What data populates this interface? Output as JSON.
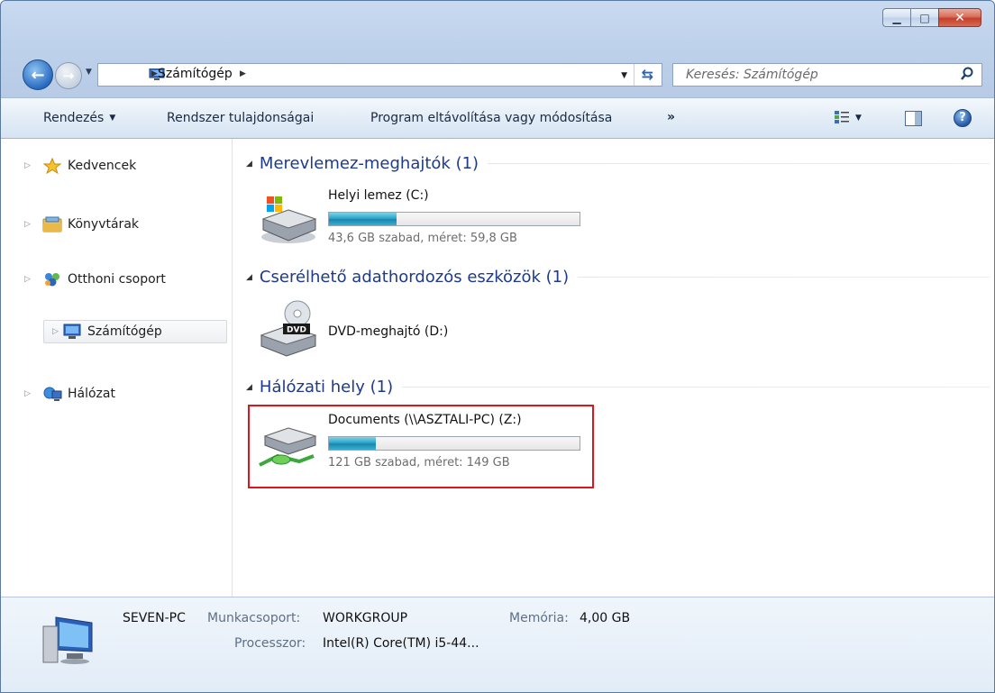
{
  "address": {
    "crumbs": [
      "Számítógép"
    ]
  },
  "search": {
    "placeholder": "Keresés: Számítógép"
  },
  "toolbar": {
    "organize": "Rendezés",
    "system_properties": "Rendszer tulajdonságai",
    "uninstall": "Program eltávolítása vagy módosítása",
    "more": "»"
  },
  "nav_pane": {
    "items": [
      {
        "label": "Kedvencek",
        "icon": "star-icon"
      },
      {
        "label": "Könyvtárak",
        "icon": "libraries-icon"
      },
      {
        "label": "Otthoni csoport",
        "icon": "homegroup-icon"
      },
      {
        "label": "Számítógép",
        "icon": "computer-icon",
        "selected": true
      },
      {
        "label": "Hálózat",
        "icon": "network-icon"
      }
    ]
  },
  "groups": [
    {
      "title": "Merevlemez-meghajtók (1)",
      "drives": [
        {
          "name": "Helyi lemez (C:)",
          "size_text": "43,6 GB szabad, méret: 59,8 GB",
          "used_fraction": 0.271,
          "icon": "hard-drive-icon"
        }
      ]
    },
    {
      "title": "Cserélhető adathordozós eszközök (1)",
      "drives": [
        {
          "name": "DVD-meghajtó (D:)",
          "icon": "dvd-drive-icon",
          "icon_label": "DVD"
        }
      ]
    },
    {
      "title": "Hálózati hely (1)",
      "drives": [
        {
          "name": "Documents (\\\\ASZTALI-PC) (Z:)",
          "size_text": "121 GB szabad, méret: 149 GB",
          "used_fraction": 0.188,
          "icon": "network-drive-icon"
        }
      ]
    }
  ],
  "details": {
    "pc_name": "SEVEN-PC",
    "workgroup_label": "Munkacsoport:",
    "workgroup": "WORKGROUP",
    "memory_label": "Memória:",
    "memory": "4,00 GB",
    "processor_label": "Processzor:",
    "processor": "Intel(R) Core(TM) i5-44..."
  },
  "colors": {
    "group_header": "#1e3a8a",
    "highlight": "#e0141d",
    "bar_fill": "#2aa6c9"
  }
}
